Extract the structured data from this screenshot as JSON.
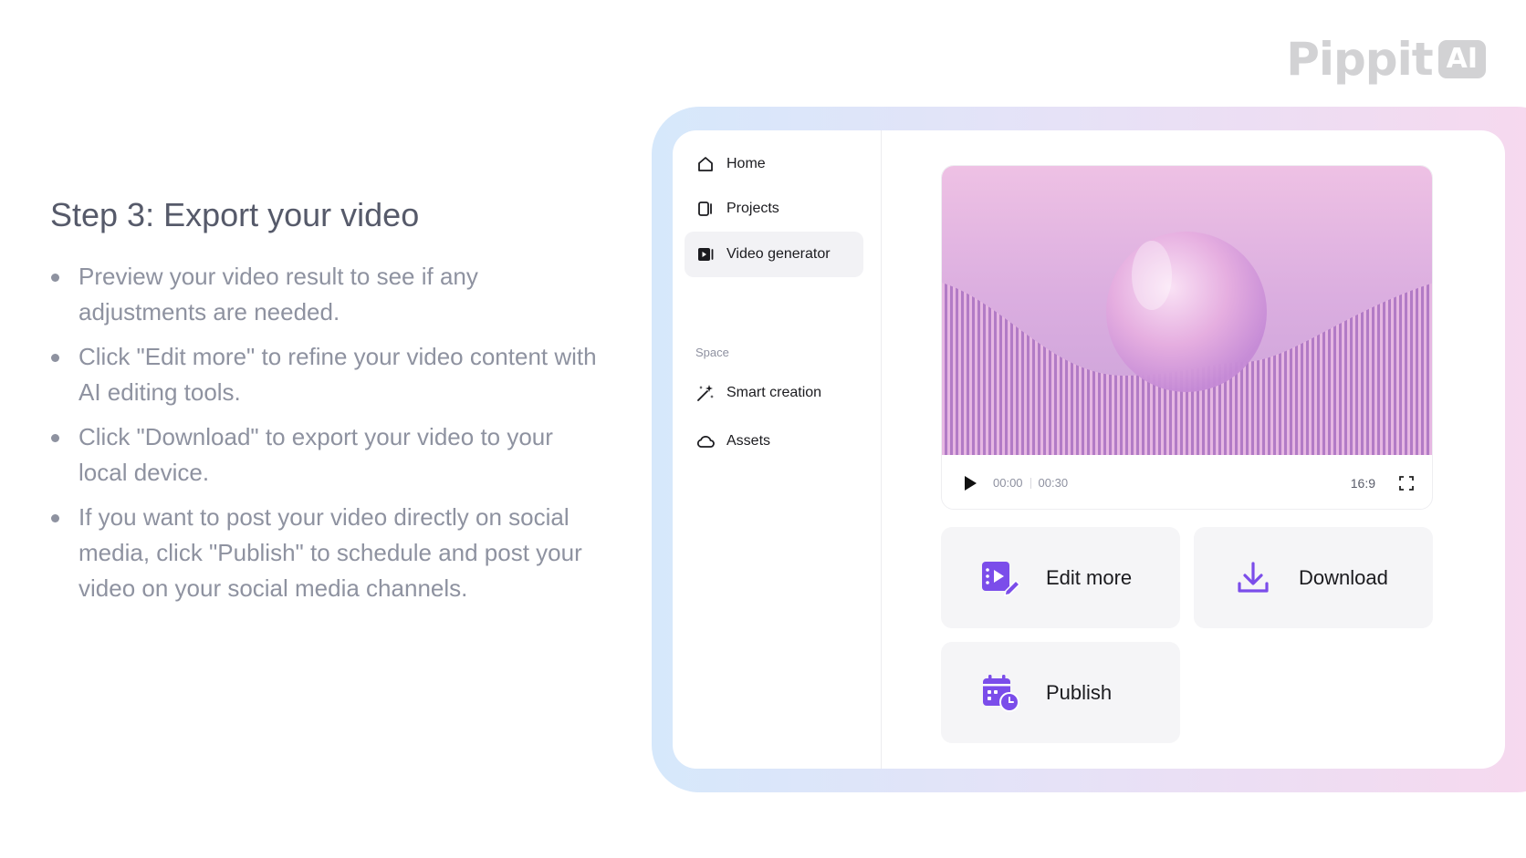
{
  "brand": {
    "logo_text": "Pippit",
    "logo_badge": "AI"
  },
  "step": {
    "title": "Step 3: Export your video",
    "bullets": [
      "Preview your video result to see if any adjustments are needed.",
      "Click \"Edit more\" to refine your video content with AI editing tools.",
      "Click \"Download\" to export your video to your local device.",
      "If you want to post your video directly on social media, click \"Publish\" to schedule and post your video on your social media channels."
    ]
  },
  "sidebar": {
    "items": [
      {
        "label": "Home",
        "icon": "home-icon"
      },
      {
        "label": "Projects",
        "icon": "projects-icon"
      },
      {
        "label": "Video generator",
        "icon": "video-generator-icon",
        "active": true
      }
    ],
    "section_label": "Space",
    "space_items": [
      {
        "label": "Smart creation",
        "icon": "magic-wand-icon"
      },
      {
        "label": "Assets",
        "icon": "cloud-icon"
      }
    ]
  },
  "player": {
    "current_time": "00:00",
    "duration": "00:30",
    "aspect_ratio": "16:9"
  },
  "actions": {
    "edit_more": "Edit more",
    "download": "Download",
    "publish": "Publish"
  },
  "colors": {
    "accent": "#7b4dea",
    "title_text": "#565a6a",
    "body_text": "#8e92a0",
    "card_bg": "#f5f5f7"
  }
}
